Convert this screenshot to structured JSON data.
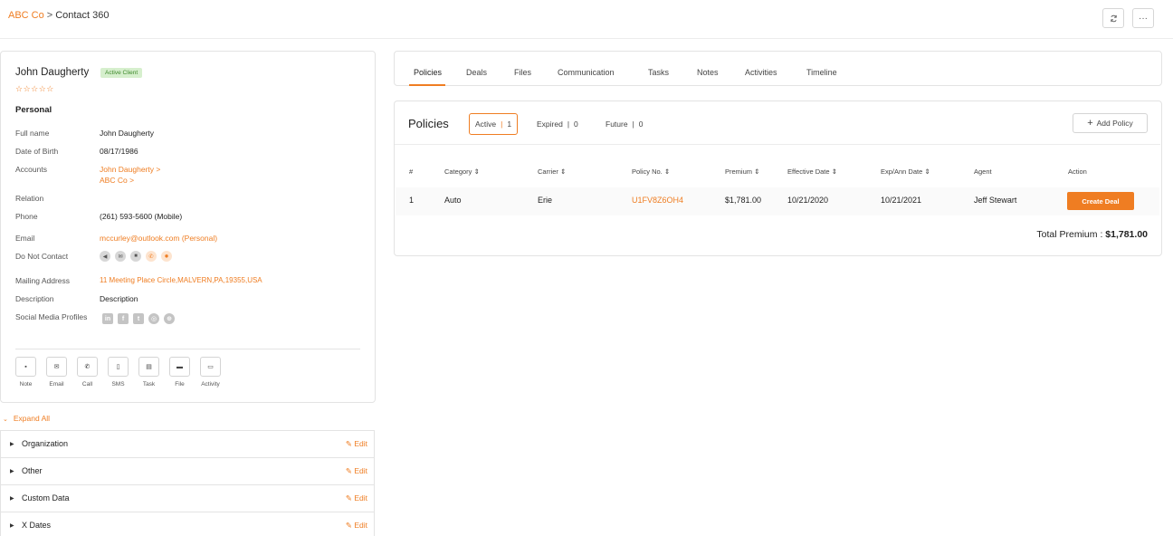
{
  "breadcrumb": {
    "parent": "ABC Co",
    "separator": ">",
    "current": "Contact 360"
  },
  "top_actions": {
    "refresh_icon": "refresh-icon",
    "more_label": "···"
  },
  "contact": {
    "name": "John Daugherty",
    "status_badge": "Active Client",
    "stars": "☆☆☆☆☆",
    "section_title": "Personal",
    "fields": {
      "full_name": {
        "label": "Full name",
        "value": "John Daugherty"
      },
      "dob": {
        "label": "Date of Birth",
        "value": "08/17/1986"
      },
      "accounts": {
        "label": "Accounts",
        "value1": "John Daugherty >",
        "value2": "ABC Co >"
      },
      "relation": {
        "label": "Relation",
        "value": ""
      },
      "phone": {
        "label": "Phone",
        "value": "(261) 593-5600 (Mobile)"
      },
      "email": {
        "label": "Email",
        "value": "mccurley@outlook.com  (Personal)"
      },
      "dnc": {
        "label": "Do Not Contact"
      },
      "mailing": {
        "label": "Mailing Address",
        "value": "11 Meeting Place Circle,MALVERN,PA,19355,USA"
      },
      "description": {
        "label": "Description",
        "value": "Description"
      },
      "social": {
        "label": "Social Media Profiles"
      }
    },
    "quick_actions": [
      {
        "label": "Note",
        "icon": "note-icon"
      },
      {
        "label": "Email",
        "icon": "email-icon"
      },
      {
        "label": "Call",
        "icon": "call-icon"
      },
      {
        "label": "SMS",
        "icon": "sms-icon"
      },
      {
        "label": "Task",
        "icon": "task-icon"
      },
      {
        "label": "File",
        "icon": "file-icon"
      },
      {
        "label": "Activity",
        "icon": "activity-icon"
      }
    ]
  },
  "accordion": {
    "expand_all": "Expand All",
    "edit_label": "Edit",
    "sections": [
      "Organization",
      "Other",
      "Custom Data",
      "X Dates"
    ]
  },
  "tabs": [
    "Policies",
    "Deals",
    "Files",
    "Communication",
    "Tasks",
    "Notes",
    "Activities",
    "Timeline"
  ],
  "policies": {
    "title": "Policies",
    "filters": [
      {
        "label": "Active",
        "count": "1"
      },
      {
        "label": "Expired",
        "count": "0"
      },
      {
        "label": "Future",
        "count": "0"
      }
    ],
    "add_label": "Add Policy",
    "columns": [
      "#",
      "Category",
      "Carrier",
      "Policy No.",
      "Premium",
      "Effective Date",
      "Exp/Ann Date",
      "Agent",
      "Action"
    ],
    "rows": [
      {
        "num": "1",
        "category": "Auto",
        "carrier": "Erie",
        "policy_no": "U1FV8Z6OH4",
        "premium": "$1,781.00",
        "effective": "10/21/2020",
        "expiry": "10/21/2021",
        "agent": "Jeff Stewart",
        "action": "Create Deal"
      }
    ],
    "total_label": "Total Premium :",
    "total_value": "$1,781.00"
  },
  "colors": {
    "accent": "#ef7d22",
    "badge_bg": "#d6efcd",
    "badge_text": "#3f8a2c"
  }
}
